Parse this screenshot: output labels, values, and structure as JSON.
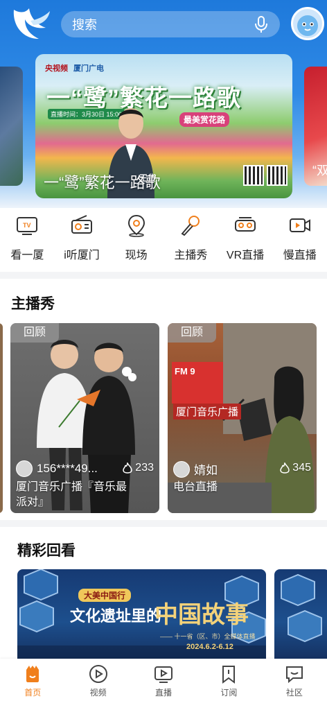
{
  "header": {
    "search_placeholder": "搜索"
  },
  "banner": {
    "brand_left": "央视频",
    "brand_right": "厦门广电",
    "headline": "一“鹭”繁花一路歌",
    "time_label": "直播时间：3月30日 15:00",
    "tag": "最美赏花路",
    "host_name": "王货",
    "caption": "一“鹭”繁花一路歌",
    "right_peek_text": "“双"
  },
  "quicknav": [
    {
      "label": "看一厦",
      "icon": "tv-icon"
    },
    {
      "label": "i听厦门",
      "icon": "radio-icon"
    },
    {
      "label": "现场",
      "icon": "location-icon"
    },
    {
      "label": "主播秀",
      "icon": "microphone-icon"
    },
    {
      "label": "VR直播",
      "icon": "vr-headset-icon"
    },
    {
      "label": "慢直播",
      "icon": "video-camera-icon"
    }
  ],
  "anchor_section": {
    "title": "主播秀",
    "cards": [
      {
        "tag": "回顾",
        "user": "156****49...",
        "views": "233",
        "desc": "厦门音乐广播『音乐最派对』"
      },
      {
        "tag": "回顾",
        "user": "婧如",
        "views": "345",
        "desc": "电台直播",
        "studio_sign": "厦门音乐广播",
        "studio_logo": "FM 9"
      }
    ]
  },
  "replay_section": {
    "title": "精彩回看",
    "card": {
      "badge": "大美中国行",
      "title_small": "文化遗址里的",
      "title_big": "中国故事",
      "subtitle": "—— 十一省（区、市）全媒体直播",
      "dates": "2024.6.2-6.12"
    }
  },
  "tabbar": [
    {
      "label": "首页",
      "icon": "home-icon",
      "active": true
    },
    {
      "label": "视频",
      "icon": "play-circle-icon"
    },
    {
      "label": "直播",
      "icon": "live-tv-icon"
    },
    {
      "label": "订阅",
      "icon": "bookmark-icon"
    },
    {
      "label": "社区",
      "icon": "chat-bubble-icon"
    }
  ],
  "colors": {
    "brand_blue": "#1e79db",
    "accent_orange": "#f07f1c"
  }
}
